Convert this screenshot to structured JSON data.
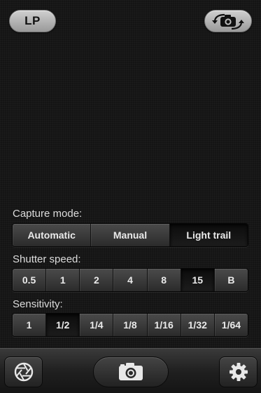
{
  "header": {
    "lp_label": "LP",
    "switch_camera_icon": "camera-switch-icon"
  },
  "capture_mode": {
    "label": "Capture mode:",
    "options": [
      "Automatic",
      "Manual",
      "Light trail"
    ],
    "selected": "Light trail"
  },
  "shutter_speed": {
    "label": "Shutter speed:",
    "options": [
      "0.5",
      "1",
      "2",
      "4",
      "8",
      "15",
      "B"
    ],
    "selected": "15"
  },
  "sensitivity": {
    "label": "Sensitivity:",
    "options": [
      "1",
      "1/2",
      "1/4",
      "1/8",
      "1/16",
      "1/32",
      "1/64"
    ],
    "selected": "1/2"
  },
  "toolbar": {
    "left_icon": "aperture-icon",
    "center_icon": "camera-icon",
    "right_icon": "gear-icon"
  },
  "colors": {
    "background": "#141414",
    "pill": "#b5b5b5",
    "segment": "#3a3a3a",
    "segment_selected": "#111111"
  }
}
